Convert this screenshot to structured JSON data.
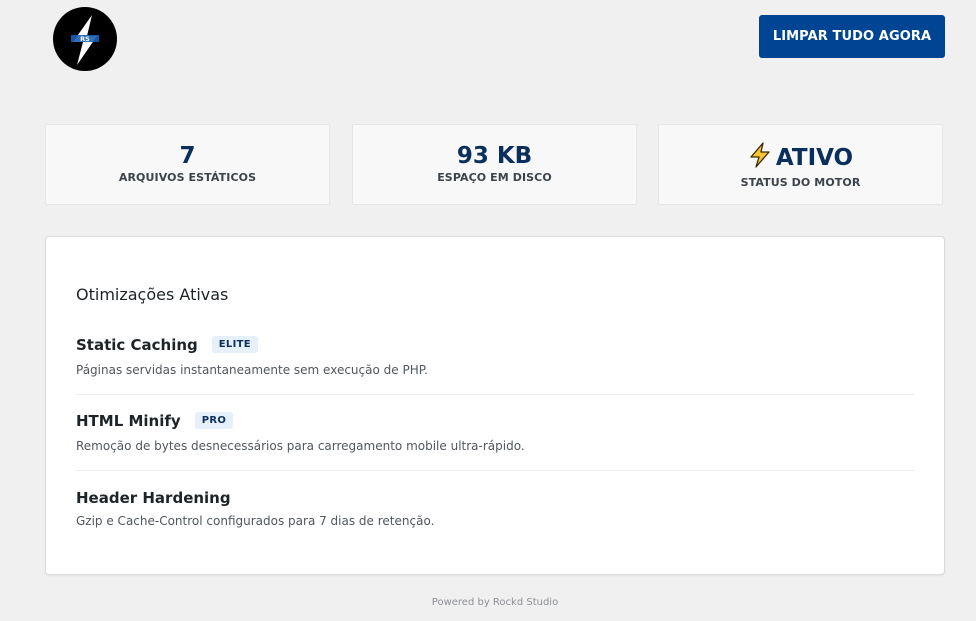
{
  "header": {
    "logo_icon": "lightning-logo-icon",
    "clear_button_label": "LIMPAR TUDO AGORA"
  },
  "stats": [
    {
      "value": "7",
      "label": "ARQUIVOS ESTÁTICOS"
    },
    {
      "value": "93 KB",
      "label": "ESPAÇO EM DISCO"
    },
    {
      "value": "ATIVO",
      "label": "STATUS DO MOTOR",
      "icon": "lightning-icon"
    }
  ],
  "optimizations": {
    "title": "Otimizações Ativas",
    "items": [
      {
        "name": "Static Caching",
        "badge": "ELITE",
        "description": "Páginas servidas instantaneamente sem execução de PHP."
      },
      {
        "name": "HTML Minify",
        "badge": "PRO",
        "description": "Remoção de bytes desnecessários para carregamento mobile ultra-rápido."
      },
      {
        "name": "Header Hardening",
        "description": "Gzip e Cache-Control configurados para 7 dias de retenção."
      }
    ]
  },
  "footer": {
    "text": "Powered by Rockd Studio"
  },
  "colors": {
    "primary": "#004494",
    "value_text": "#0a2f5c",
    "background": "#f0f0f1",
    "badge_bg": "#e5f0fb"
  }
}
